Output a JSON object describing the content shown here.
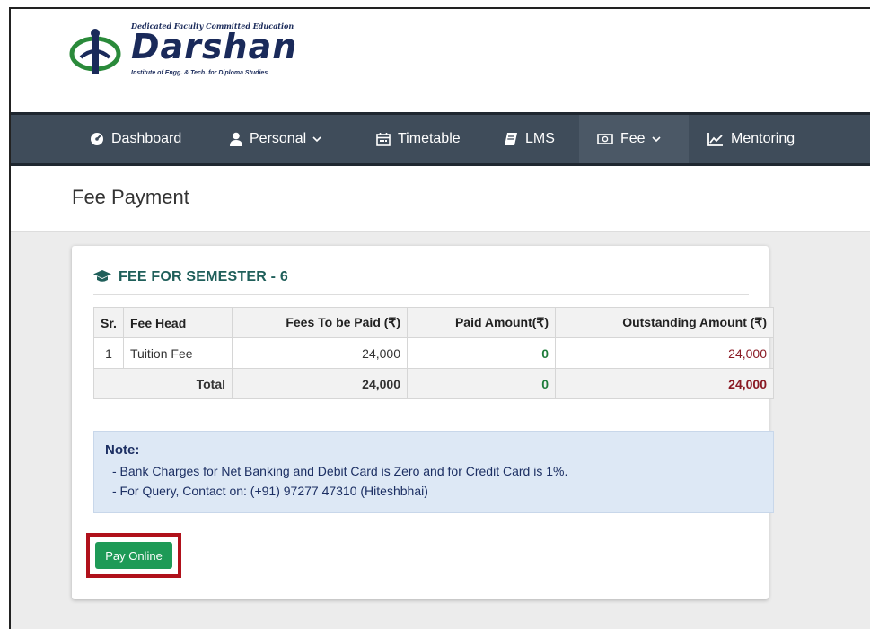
{
  "brand": {
    "tagline": "Dedicated Faculty Committed Education",
    "name": "Darshan",
    "subtitle": "Institute of Engg. & Tech. for Diploma Studies",
    "color": "#1a2a5a"
  },
  "nav": {
    "items": [
      {
        "label": "Dashboard",
        "icon": "dashboard-icon"
      },
      {
        "label": "Personal",
        "icon": "user-icon",
        "dropdown": true
      },
      {
        "label": "Timetable",
        "icon": "calendar-icon"
      },
      {
        "label": "LMS",
        "icon": "book-icon"
      },
      {
        "label": "Fee",
        "icon": "money-icon",
        "dropdown": true,
        "active": true
      },
      {
        "label": "Mentoring",
        "icon": "line-chart-icon"
      }
    ],
    "background": "#3f4c5a"
  },
  "page": {
    "title": "Fee Payment"
  },
  "card": {
    "title": "FEE FOR SEMESTER - 6",
    "table": {
      "headers": [
        "Sr.",
        "Fee Head",
        "Fees To be Paid (₹)",
        "Paid Amount(₹)",
        "Outstanding Amount (₹)"
      ],
      "rows": [
        {
          "sr": "1",
          "fee_head": "Tuition Fee",
          "to_pay": "24,000",
          "paid": "0",
          "outstanding": "24,000"
        }
      ],
      "total": {
        "label": "Total",
        "to_pay": "24,000",
        "paid": "0",
        "outstanding": "24,000"
      }
    },
    "note": {
      "title": "Note:",
      "lines": [
        "- Bank Charges for Net Banking and Debit Card is Zero and for Credit Card is 1%.",
        "- For Query, Contact on: (+91) 97277 47310 (Hiteshbhai)"
      ]
    },
    "pay_button": "Pay Online"
  },
  "colors": {
    "paid_green": "#1e7c3a",
    "outstanding_maroon": "#8a1a24",
    "button_green": "#1e9a57",
    "highlight_red": "#b0111b"
  }
}
